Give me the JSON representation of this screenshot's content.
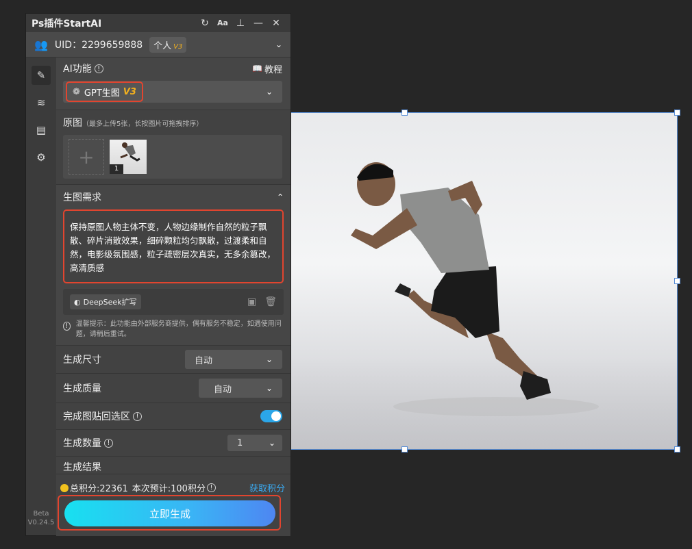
{
  "panel": {
    "title": "Ps插件StartAI",
    "uid_label": "UID：2299659888",
    "account_tag": "个人",
    "account_tag_version": "V3",
    "version_beta": "Beta",
    "version_number": "V0.24.5"
  },
  "ai": {
    "section_label": "AI功能",
    "tutorial_label": "教程",
    "selected_function": "GPT生图",
    "selected_function_version": "V3"
  },
  "source": {
    "label": "原图",
    "hint": "（最多上传5张，长按图片可拖拽排序）",
    "thumb_index": "1"
  },
  "prompt": {
    "label": "生图需求",
    "text": "保持原图人物主体不变，人物边缘制作自然的粒子飘散、碎片消散效果，细碎颗粒均匀飘散，过渡柔和自然，电影级氛围感，粒子疏密层次真实，无多余篡改，高清质感",
    "expand_label": "DeepSeek扩写",
    "notice": "温馨提示：此功能由外部服务商提供，偶有服务不稳定，如遇使用问题，请稍后重试。"
  },
  "options": {
    "size_label": "生成尺寸",
    "size_value": "自动",
    "quality_label": "生成质量",
    "quality_value": "自动",
    "paste_back_label": "完成图贴回选区",
    "paste_back_on": true,
    "count_label": "生成数量",
    "count_value": "1",
    "result_label": "生成结果"
  },
  "footer": {
    "points_label": "总积分:22361",
    "estimate_label": "本次预计:100积分",
    "get_points_label": "获取积分",
    "generate_label": "立即生成"
  },
  "colors": {
    "accent_red": "#e2452f",
    "toggle_blue": "#2ba6e8",
    "link_blue": "#3aa9f0",
    "v3_gold": "#f2b01e"
  },
  "icons": [
    "refresh-icon",
    "font-size-icon",
    "pin-icon",
    "minimize-icon",
    "close-icon",
    "users-icon",
    "chevron-down-icon",
    "edit-icon",
    "layers-icon",
    "document-icon",
    "gear-icon",
    "info-icon",
    "book-icon",
    "ai-flower-icon",
    "add-icon",
    "chevron-up-icon",
    "whale-icon",
    "clipboard-icon",
    "trash-icon",
    "coin-icon"
  ]
}
